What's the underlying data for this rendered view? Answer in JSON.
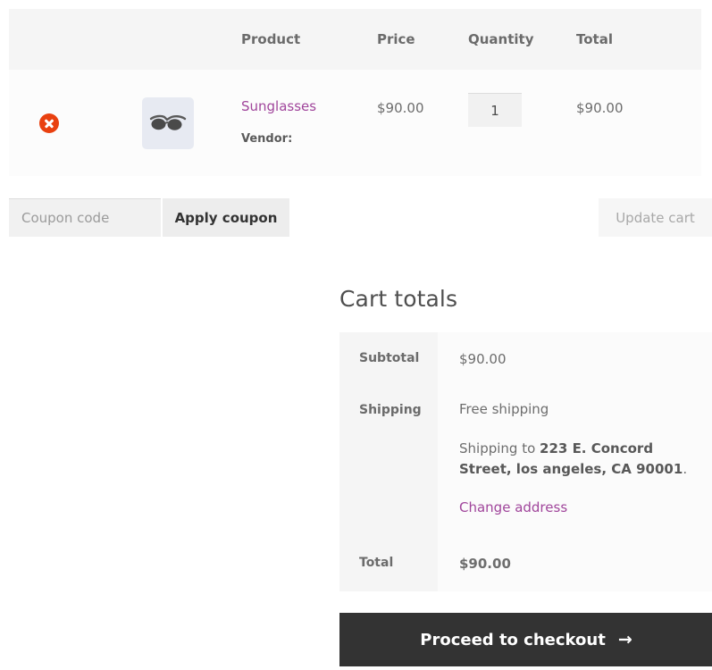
{
  "cart_table": {
    "headers": {
      "remove": "",
      "thumbnail": "",
      "product": "Product",
      "price": "Price",
      "quantity": "Quantity",
      "total": "Total"
    },
    "items": [
      {
        "remove_icon": "remove-circle-icon",
        "thumbnail_icon": "sunglasses-product-image",
        "name": "Sunglasses",
        "vendor_label": "Vendor:",
        "vendor_value": "",
        "price": "$90.00",
        "quantity": "1",
        "line_total": "$90.00"
      }
    ]
  },
  "actions": {
    "coupon_placeholder": "Coupon code",
    "coupon_value": "",
    "apply_coupon_label": "Apply coupon",
    "update_cart_label": "Update cart"
  },
  "cart_totals": {
    "title": "Cart totals",
    "subtotal_label": "Subtotal",
    "subtotal_value": "$90.00",
    "shipping_label": "Shipping",
    "shipping_method": "Free shipping",
    "shipping_to_prefix": "Shipping to ",
    "shipping_address": "223 E. Concord Street, los angeles, CA 90001",
    "shipping_to_suffix": ".",
    "change_address_label": "Change address",
    "total_label": "Total",
    "total_value": "$90.00"
  },
  "checkout": {
    "label": "Proceed to checkout",
    "arrow_icon": "→"
  },
  "colors": {
    "link": "#a0459b",
    "remove_button": "#e9400f",
    "checkout_button": "#333333",
    "header_row": "#f5f5f5",
    "thumbnail_bg": "#e7eaf2"
  }
}
